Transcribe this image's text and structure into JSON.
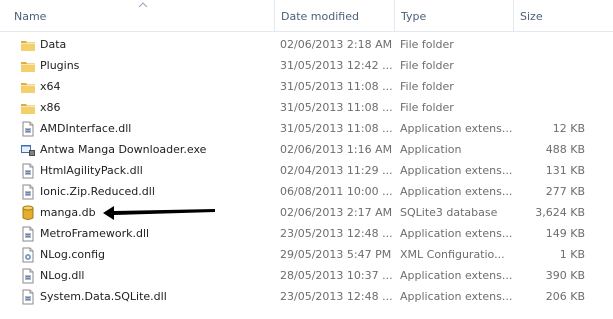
{
  "columns": {
    "name": "Name",
    "date": "Date modified",
    "type": "Type",
    "size": "Size"
  },
  "files": [
    {
      "name": "Data",
      "date": "02/06/2013 2:18 AM",
      "type": "File folder",
      "size": "",
      "icon": "folder-icon"
    },
    {
      "name": "Plugins",
      "date": "31/05/2013 12:42 ...",
      "type": "File folder",
      "size": "",
      "icon": "folder-icon"
    },
    {
      "name": "x64",
      "date": "31/05/2013 11:08 ...",
      "type": "File folder",
      "size": "",
      "icon": "folder-icon"
    },
    {
      "name": "x86",
      "date": "31/05/2013 11:08 ...",
      "type": "File folder",
      "size": "",
      "icon": "folder-icon"
    },
    {
      "name": "AMDInterface.dll",
      "date": "31/05/2013 11:08 ...",
      "type": "Application extens...",
      "size": "12 KB",
      "icon": "dll-icon"
    },
    {
      "name": "Antwa Manga Downloader.exe",
      "date": "02/06/2013 1:16 AM",
      "type": "Application",
      "size": "488 KB",
      "icon": "exe-icon"
    },
    {
      "name": "HtmlAgilityPack.dll",
      "date": "02/04/2013 11:29 ...",
      "type": "Application extens...",
      "size": "131 KB",
      "icon": "dll-icon"
    },
    {
      "name": "Ionic.Zip.Reduced.dll",
      "date": "06/08/2011 10:00 ...",
      "type": "Application extens...",
      "size": "277 KB",
      "icon": "dll-icon"
    },
    {
      "name": "manga.db",
      "date": "02/06/2013 2:17 AM",
      "type": "SQLite3 database",
      "size": "3,624 KB",
      "icon": "database-icon"
    },
    {
      "name": "MetroFramework.dll",
      "date": "23/05/2013 12:48 ...",
      "type": "Application extens...",
      "size": "149 KB",
      "icon": "dll-icon"
    },
    {
      "name": "NLog.config",
      "date": "29/05/2013 5:47 PM",
      "type": "XML Configuratio...",
      "size": "1 KB",
      "icon": "config-icon"
    },
    {
      "name": "NLog.dll",
      "date": "28/05/2013 10:37 ...",
      "type": "Application extens...",
      "size": "390 KB",
      "icon": "dll-icon"
    },
    {
      "name": "System.Data.SQLite.dll",
      "date": "23/05/2013 12:48 ...",
      "type": "Application extens...",
      "size": "206 KB",
      "icon": "dll-icon"
    }
  ],
  "colors": {
    "header_text": "#4c607a",
    "folder": "#e8c35a",
    "secondary_text": "#6d6d6d"
  }
}
